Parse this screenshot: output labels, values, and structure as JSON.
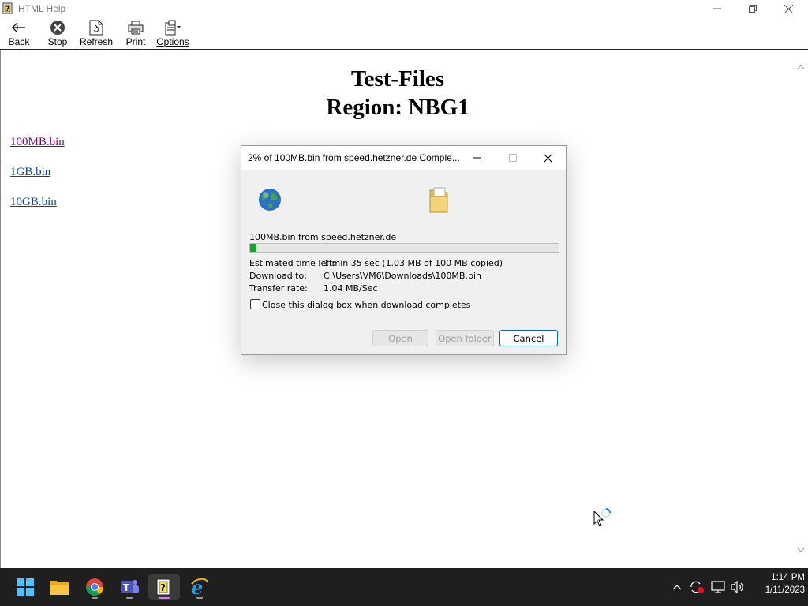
{
  "window": {
    "title": "HTML Help"
  },
  "toolbar": {
    "buttons": [
      {
        "label": "Back",
        "icon": "back-arrow-icon"
      },
      {
        "label": "Stop",
        "icon": "stop-icon"
      },
      {
        "label": "Refresh",
        "icon": "refresh-icon"
      },
      {
        "label": "Print",
        "icon": "printer-icon"
      },
      {
        "label": "Options",
        "icon": "options-icon"
      }
    ]
  },
  "page": {
    "title_line1": "Test-Files",
    "title_line2": "Region: NBG1",
    "links": [
      "100MB.bin",
      "1GB.bin",
      "10GB.bin"
    ],
    "visited_link_color": "#800080",
    "link_color": "#0000ee"
  },
  "dialog": {
    "title": "2% of 100MB.bin from speed.hetzner.de Comple...",
    "source": "100MB.bin from speed.hetzner.de",
    "progress_percent": 2,
    "estimated_label": "Estimated time left:",
    "estimated_value": "1 min 35 sec (1.03 MB of 100 MB copied)",
    "download_to_label": "Download to:",
    "download_to_value": "C:\\Users\\VM6\\Downloads\\100MB.bin",
    "rate_label": "Transfer rate:",
    "rate_value": "1.04 MB/Sec",
    "checkbox_label": "Close this dialog box when download completes",
    "checkbox_checked": false,
    "open_button": "Open",
    "open_folder_button": "Open folder",
    "cancel_button": "Cancel"
  },
  "taskbar": {
    "apps": [
      "windows-start-icon",
      "file-explorer-icon",
      "chrome-icon",
      "teams-icon",
      "html-help-icon",
      "internet-explorer-icon"
    ],
    "active_app": "html-help-icon",
    "clock_time": "1:14 PM",
    "clock_date": "1/11/2023"
  },
  "colors": {
    "accent": "#0067c0",
    "progress": "#06b025",
    "taskbar": "#1f1f1f"
  }
}
